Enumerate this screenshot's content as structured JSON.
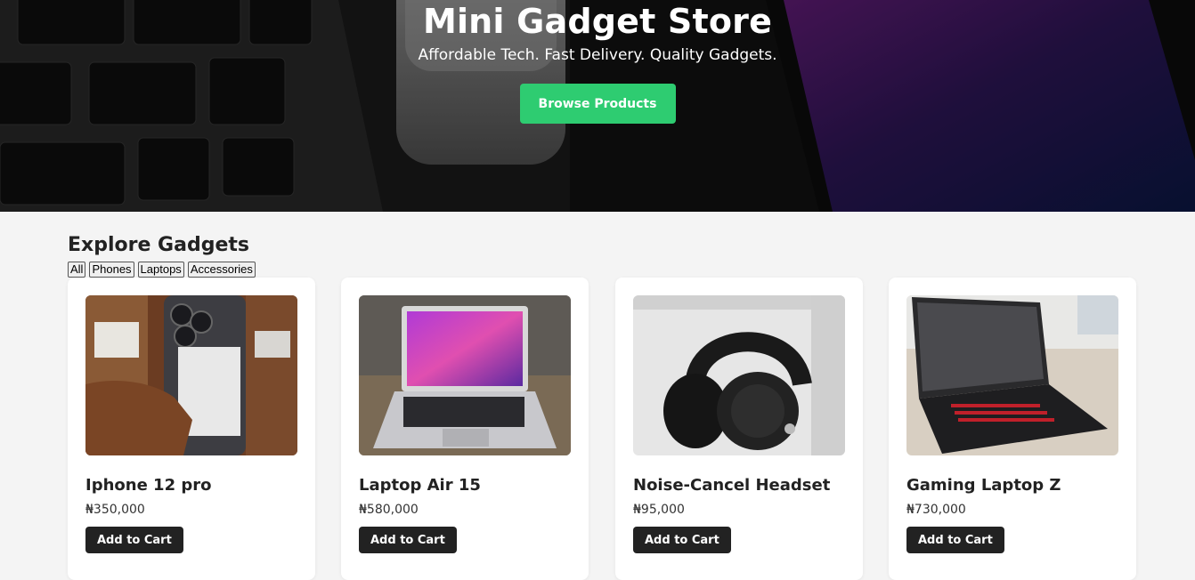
{
  "hero": {
    "title": "Mini Gadget Store",
    "subtitle": "Affordable Tech. Fast Delivery. Quality Gadgets.",
    "cta_label": "Browse Products",
    "accent_color": "#2ecc71"
  },
  "products_section": {
    "title": "Explore Gadgets",
    "filters": [
      "All",
      "Phones",
      "Laptops",
      "Accessories"
    ],
    "products": [
      {
        "name": "Iphone 12 pro",
        "price": "₦350,000",
        "button_label": "Add to Cart",
        "image_icon": "phone-photo"
      },
      {
        "name": "Laptop Air 15",
        "price": "₦580,000",
        "button_label": "Add to Cart",
        "image_icon": "laptop-photo"
      },
      {
        "name": "Noise-Cancel Headset",
        "price": "₦95,000",
        "button_label": "Add to Cart",
        "image_icon": "headset-photo"
      },
      {
        "name": "Gaming Laptop Z",
        "price": "₦730,000",
        "button_label": "Add to Cart",
        "image_icon": "gaming-laptop-photo"
      }
    ]
  }
}
